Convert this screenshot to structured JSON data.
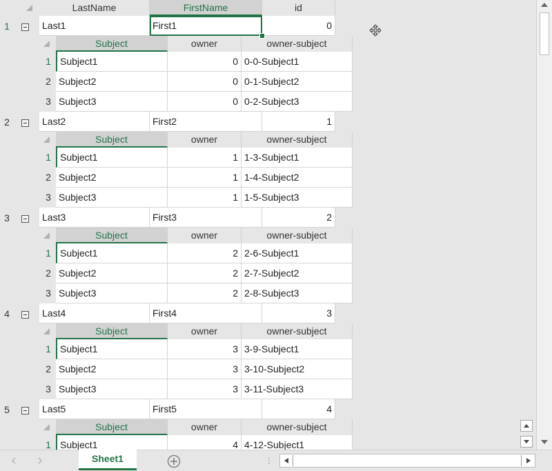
{
  "parent_columns": [
    "LastName",
    "FirstName",
    "id"
  ],
  "child_columns": [
    "Subject",
    "owner",
    "owner-subject"
  ],
  "records": [
    {
      "row": "1",
      "last": "Last1",
      "first": "First1",
      "id": "0",
      "children": [
        {
          "row": "1",
          "subject": "Subject1",
          "owner": "0",
          "owner_subject": "0-0-Subject1"
        },
        {
          "row": "2",
          "subject": "Subject2",
          "owner": "0",
          "owner_subject": "0-1-Subject2"
        },
        {
          "row": "3",
          "subject": "Subject3",
          "owner": "0",
          "owner_subject": "0-2-Subject3"
        }
      ]
    },
    {
      "row": "2",
      "last": "Last2",
      "first": "First2",
      "id": "1",
      "children": [
        {
          "row": "1",
          "subject": "Subject1",
          "owner": "1",
          "owner_subject": "1-3-Subject1"
        },
        {
          "row": "2",
          "subject": "Subject2",
          "owner": "1",
          "owner_subject": "1-4-Subject2"
        },
        {
          "row": "3",
          "subject": "Subject3",
          "owner": "1",
          "owner_subject": "1-5-Subject3"
        }
      ]
    },
    {
      "row": "3",
      "last": "Last3",
      "first": "First3",
      "id": "2",
      "children": [
        {
          "row": "1",
          "subject": "Subject1",
          "owner": "2",
          "owner_subject": "2-6-Subject1"
        },
        {
          "row": "2",
          "subject": "Subject2",
          "owner": "2",
          "owner_subject": "2-7-Subject2"
        },
        {
          "row": "3",
          "subject": "Subject3",
          "owner": "2",
          "owner_subject": "2-8-Subject3"
        }
      ]
    },
    {
      "row": "4",
      "last": "Last4",
      "first": "First4",
      "id": "3",
      "children": [
        {
          "row": "1",
          "subject": "Subject1",
          "owner": "3",
          "owner_subject": "3-9-Subject1"
        },
        {
          "row": "2",
          "subject": "Subject2",
          "owner": "3",
          "owner_subject": "3-10-Subject2"
        },
        {
          "row": "3",
          "subject": "Subject3",
          "owner": "3",
          "owner_subject": "3-11-Subject3"
        }
      ]
    },
    {
      "row": "5",
      "last": "Last5",
      "first": "First5",
      "id": "4",
      "children": [
        {
          "row": "1",
          "subject": "Subject1",
          "owner": "4",
          "owner_subject": "4-12-Subject1"
        }
      ]
    }
  ],
  "sheet_tab": "Sheet1",
  "add_sheet_icon": "plus-circle-icon",
  "colors": {
    "accent": "#217346",
    "grid": "#d4d4d4",
    "background": "#e6e6e6"
  }
}
